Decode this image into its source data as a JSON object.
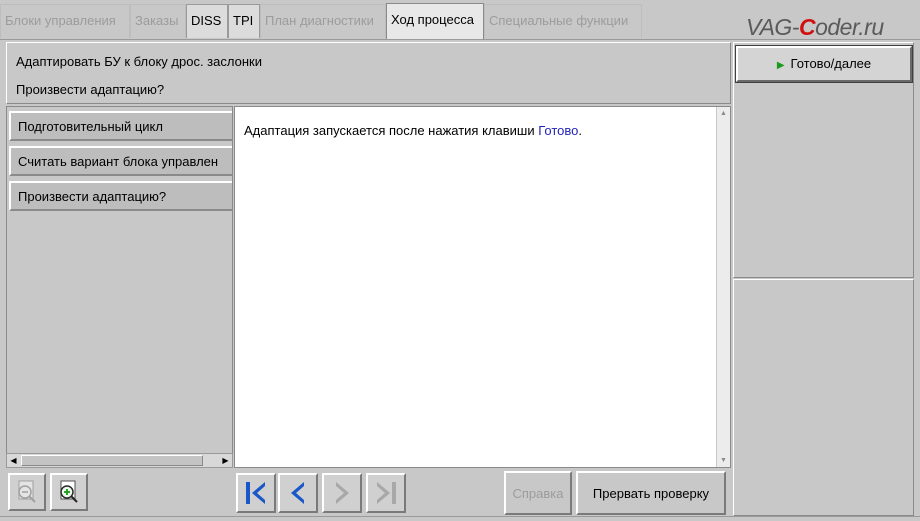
{
  "tabs": [
    {
      "label": "Блоки управления",
      "state": "disabled"
    },
    {
      "label": "Заказы",
      "state": "disabled"
    },
    {
      "label": "DISS",
      "state": "enabled"
    },
    {
      "label": "TPI",
      "state": "enabled"
    },
    {
      "label": "План диагностики",
      "state": "disabled"
    },
    {
      "label": "Ход процесса",
      "state": "active"
    },
    {
      "label": "Специальные функции",
      "state": "disabled"
    }
  ],
  "logo": {
    "prefix": "VAG-",
    "accent": "C",
    "suffix": "oder.ru",
    "accent_color": "#d01010"
  },
  "header": {
    "title": "Адаптировать БУ к блоку дрос. заслонки",
    "question": "Произвести адаптацию?"
  },
  "steps": [
    {
      "label": "Подготовительный цикл"
    },
    {
      "label": "Считать вариант блока управлен"
    },
    {
      "label": "Произвести адаптацию?"
    }
  ],
  "content": {
    "message": "Адаптация запускается после нажатия клавиши ",
    "message_link": "Готово",
    "message_end": "."
  },
  "right": {
    "next_button": "Готово/далее",
    "next_icon": "play-triangle-icon",
    "next_icon_color": "#1a9a1a"
  },
  "bottom": {
    "zoom_out_icon": "zoom-out-icon",
    "zoom_in_icon": "zoom-in-icon",
    "nav_icons": [
      "first-page-icon",
      "previous-icon",
      "next-icon",
      "last-page-icon"
    ],
    "help_button": "Справка",
    "abort_button": "Прервать проверку"
  },
  "colors": {
    "nav_active": "#1a57c8",
    "nav_disabled": "#a8a8a8",
    "link": "#2323b8"
  }
}
